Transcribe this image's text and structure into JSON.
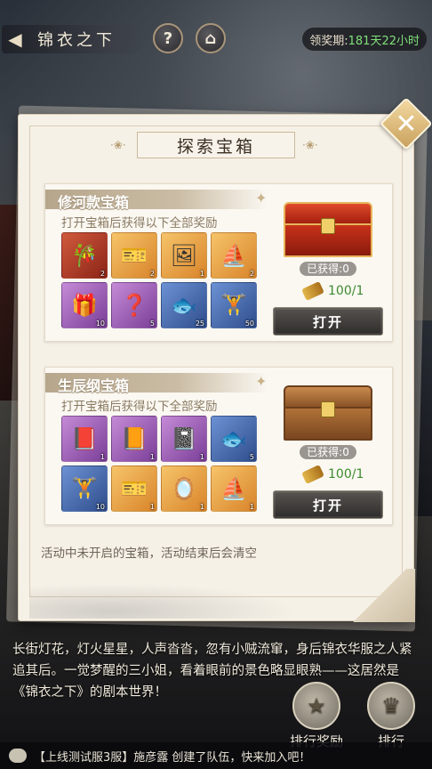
{
  "header": {
    "back_title": "锦衣之下",
    "help_label": "?",
    "timer_label": "领奖期:",
    "timer_value": "181天22小时"
  },
  "dialog": {
    "title": "探索宝箱",
    "notice": "活动中未开启的宝箱，活动结束后会清空",
    "chests": [
      {
        "name": "修河款宝箱",
        "desc": "打开宝箱后获得以下全部奖励",
        "obtained": "已获得:0",
        "cost": "100/1",
        "open_label": "打开",
        "items": [
          {
            "icon": "jade-scroll-icon",
            "rarity": "red",
            "qty": "2"
          },
          {
            "icon": "ticket-icon",
            "rarity": "gold",
            "qty": "2"
          },
          {
            "icon": "photo-card-icon",
            "rarity": "gold",
            "qty": "1"
          },
          {
            "icon": "sailboat-icon",
            "rarity": "gold",
            "qty": "2"
          },
          {
            "icon": "gift-box-icon",
            "rarity": "purple",
            "qty": "10"
          },
          {
            "icon": "mystery-coin-icon",
            "rarity": "purple",
            "qty": "5"
          },
          {
            "icon": "fish-dish-icon",
            "rarity": "blue",
            "qty": "25"
          },
          {
            "icon": "dumbbell-icon",
            "rarity": "blue",
            "qty": "50"
          }
        ]
      },
      {
        "name": "生辰纲宝箱",
        "desc": "打开宝箱后获得以下全部奖励",
        "obtained": "已获得:0",
        "cost": "100/1",
        "open_label": "打开",
        "items": [
          {
            "icon": "red-book-icon",
            "rarity": "purple",
            "qty": "1"
          },
          {
            "icon": "orange-book-icon",
            "rarity": "purple",
            "qty": "1"
          },
          {
            "icon": "black-book-icon",
            "rarity": "purple",
            "qty": "1"
          },
          {
            "icon": "fish-dish-icon",
            "rarity": "blue",
            "qty": "5"
          },
          {
            "icon": "dumbbell-icon",
            "rarity": "blue",
            "qty": "10"
          },
          {
            "icon": "ticket-icon",
            "rarity": "gold",
            "qty": "1"
          },
          {
            "icon": "mirror-icon",
            "rarity": "gold",
            "qty": "1"
          },
          {
            "icon": "sailboat-icon",
            "rarity": "gold",
            "qty": "1"
          }
        ]
      }
    ]
  },
  "story": "长街灯花，灯火星星，人声沓沓，忽有小贼流窜，身后锦衣华服之人紧追其后。一觉梦醒的三小姐，看着眼前的景色略显眼熟——这居然是《锦衣之下》的剧本世界！",
  "side_buttons": {
    "rank_reward": "排行奖励",
    "rank": "排行"
  },
  "chat": "【上线测试服3服】施彦露 创建了队伍，快来加入吧！",
  "colors": {
    "timer_value": "#7fe07a",
    "cost_value": "#3c8a2e"
  }
}
